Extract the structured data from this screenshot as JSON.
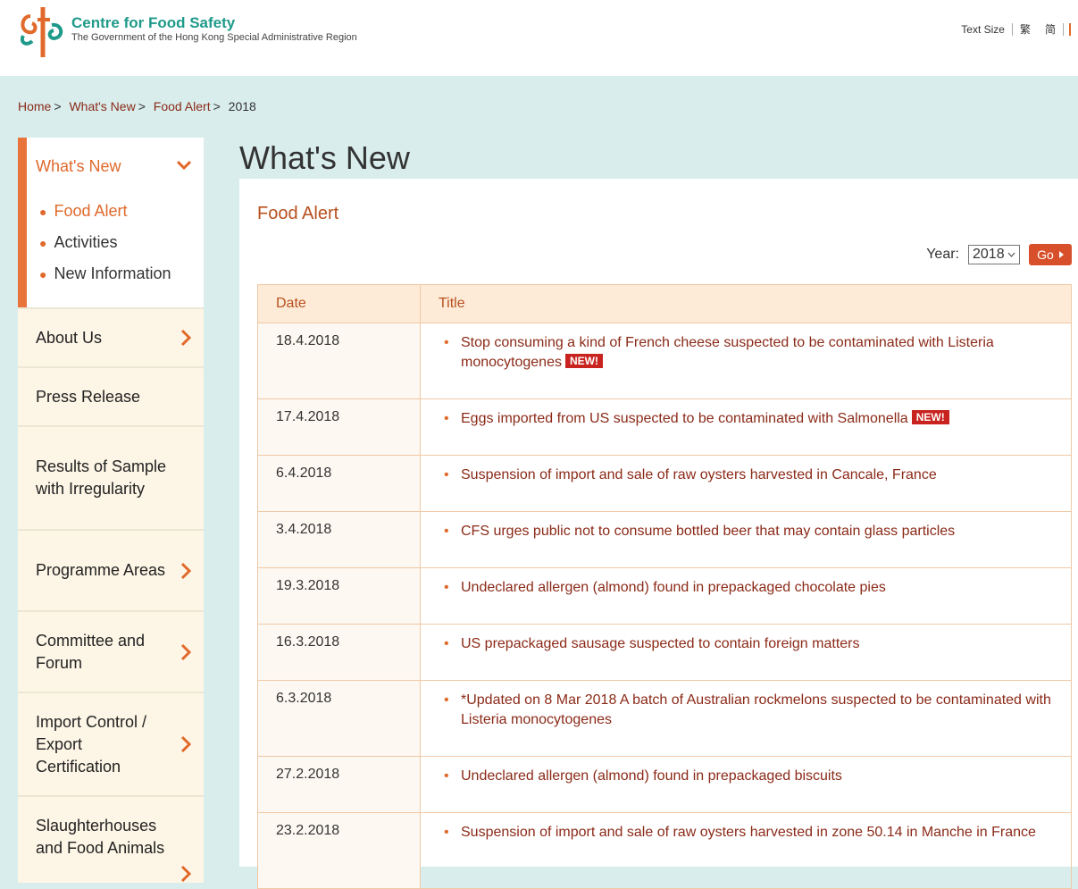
{
  "header": {
    "org_name": "Centre for Food Safety",
    "org_sub": "The Government of the Hong Kong Special Administrative Region",
    "text_size": "Text Size",
    "lang_tc": "繁",
    "lang_sc": "简"
  },
  "breadcrumb": {
    "home": "Home",
    "whats_new": "What's New",
    "food_alert": "Food Alert",
    "current": "2018",
    "sep": ">"
  },
  "sidebar": {
    "active_title": "What's New",
    "sub_items": [
      "Food Alert",
      "Activities",
      "New Information"
    ],
    "items": [
      {
        "label": "About Us",
        "arrow": true
      },
      {
        "label": "Press Release",
        "arrow": false
      },
      {
        "label": "Results of Sample with Irregularity",
        "arrow": false
      },
      {
        "label": "Programme Areas",
        "arrow": true
      },
      {
        "label": "Committee and Forum",
        "arrow": true
      },
      {
        "label": "Import Control / Export Certification",
        "arrow": true
      },
      {
        "label": "Slaughterhouses and Food Animals",
        "arrow": true
      }
    ]
  },
  "main": {
    "page_title": "What's New",
    "section_title": "Food Alert",
    "year_label": "Year:",
    "year_value": "2018",
    "go_label": "Go",
    "columns": [
      "Date",
      "Title"
    ],
    "new_badge": "NEW!",
    "rows": [
      {
        "date": "18.4.2018",
        "title": "Stop consuming a kind of French cheese suspected to be contaminated with Listeria monocytogenes",
        "new": true
      },
      {
        "date": "17.4.2018",
        "title": "Eggs imported from US suspected to be contaminated with Salmonella",
        "new": true
      },
      {
        "date": "6.4.2018",
        "title": "Suspension of import and sale of raw oysters harvested in Cancale, France",
        "new": false
      },
      {
        "date": "3.4.2018",
        "title": "CFS urges public not to consume bottled beer that may contain glass particles",
        "new": false
      },
      {
        "date": "19.3.2018",
        "title": "Undeclared allergen (almond) found in prepackaged chocolate pies",
        "new": false
      },
      {
        "date": "16.3.2018",
        "title": "US prepackaged sausage suspected to contain foreign matters",
        "new": false
      },
      {
        "date": "6.3.2018",
        "title": "*Updated on 8 Mar 2018 A batch of Australian rockmelons suspected to be contaminated with Listeria monocytogenes",
        "new": false
      },
      {
        "date": "27.2.2018",
        "title": "Undeclared allergen (almond) found in prepackaged biscuits",
        "new": false
      },
      {
        "date": "23.2.2018",
        "title": "Suspension of import and sale of raw oysters harvested in zone 50.14 in Manche in France",
        "new": false
      }
    ]
  },
  "colors": {
    "accent": "#e0692b",
    "link": "#8b2a18",
    "badge": "#c8231f",
    "teal": "#1f9a8a"
  }
}
